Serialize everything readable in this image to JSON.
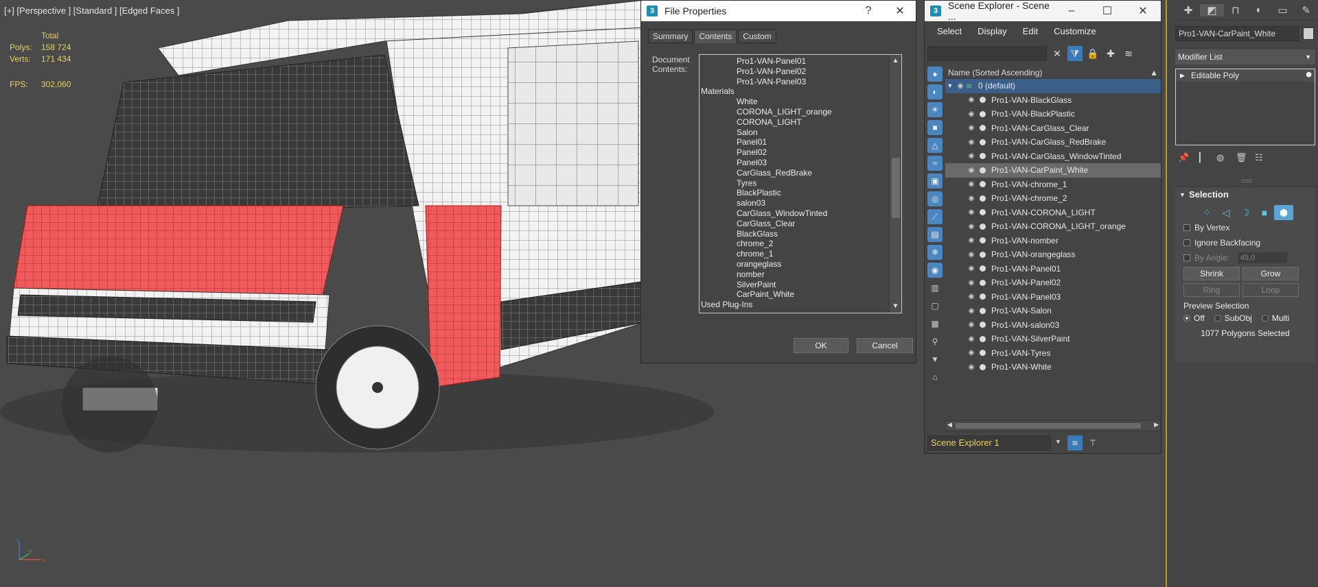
{
  "viewport": {
    "label": "[+] [Perspective ] [Standard ] [Edged Faces ]",
    "stats": {
      "total_label": "Total",
      "polys_label": "Polys:",
      "polys_value": "158 724",
      "verts_label": "Verts:",
      "verts_value": "171 434",
      "fps_label": "FPS:",
      "fps_value": "302,060"
    },
    "axis": {
      "x": "x",
      "y": "y",
      "z": "z"
    }
  },
  "file_properties": {
    "title": "File Properties",
    "help": "?",
    "close": "✕",
    "tabs": [
      "Summary",
      "Contents",
      "Custom"
    ],
    "active_tab": "Contents",
    "doc_label": "Document Contents:",
    "items": [
      {
        "text": "Pro1-VAN-Panel01",
        "indent": true
      },
      {
        "text": "Pro1-VAN-Panel02",
        "indent": true
      },
      {
        "text": "Pro1-VAN-Panel03",
        "indent": true
      },
      {
        "text": "Materials",
        "indent": false
      },
      {
        "text": "White",
        "indent": true
      },
      {
        "text": "CORONA_LIGHT_orange",
        "indent": true
      },
      {
        "text": "CORONA_LIGHT",
        "indent": true
      },
      {
        "text": "Salon",
        "indent": true
      },
      {
        "text": "Panel01",
        "indent": true
      },
      {
        "text": "Panel02",
        "indent": true
      },
      {
        "text": "Panel03",
        "indent": true
      },
      {
        "text": "CarGlass_RedBrake",
        "indent": true
      },
      {
        "text": "Tyres",
        "indent": true
      },
      {
        "text": "BlackPlastic",
        "indent": true
      },
      {
        "text": "salon03",
        "indent": true
      },
      {
        "text": "CarGlass_WindowTinted",
        "indent": true
      },
      {
        "text": "CarGlass_Clear",
        "indent": true
      },
      {
        "text": "BlackGlass",
        "indent": true
      },
      {
        "text": "chrome_2",
        "indent": true
      },
      {
        "text": "chrome_1",
        "indent": true
      },
      {
        "text": "orangeglass",
        "indent": true
      },
      {
        "text": "nomber",
        "indent": true
      },
      {
        "text": "SilverPaint",
        "indent": true
      },
      {
        "text": "CarPaint_White",
        "indent": true
      },
      {
        "text": "Used Plug-Ins",
        "indent": false
      }
    ],
    "ok": "OK",
    "cancel": "Cancel"
  },
  "scene_explorer": {
    "title": "Scene Explorer - Scene ...",
    "min": "–",
    "max": "☐",
    "close": "✕",
    "menu": [
      "Select",
      "Display",
      "Edit",
      "Customize"
    ],
    "column_header": "Name (Sorted Ascending)",
    "root": "0 (default)",
    "objects": [
      "Pro1-VAN-BlackGlass",
      "Pro1-VAN-BlackPlastic",
      "Pro1-VAN-CarGlass_Clear",
      "Pro1-VAN-CarGlass_RedBrake",
      "Pro1-VAN-CarGlass_WindowTinted",
      "Pro1-VAN-CarPaint_White",
      "Pro1-VAN-chrome_1",
      "Pro1-VAN-chrome_2",
      "Pro1-VAN-CORONA_LIGHT",
      "Pro1-VAN-CORONA_LIGHT_orange",
      "Pro1-VAN-nomber",
      "Pro1-VAN-orangeglass",
      "Pro1-VAN-Panel01",
      "Pro1-VAN-Panel02",
      "Pro1-VAN-Panel03",
      "Pro1-VAN-Salon",
      "Pro1-VAN-salon03",
      "Pro1-VAN-SilverPaint",
      "Pro1-VAN-Tyres",
      "Pro1-VAN-White"
    ],
    "selected_object": "Pro1-VAN-CarPaint_White",
    "explorer_name": "Scene Explorer 1"
  },
  "command_panel": {
    "object_name": "Pro1-VAN-CarPaint_White",
    "modifier_list": "Modifier List",
    "stack_item": "Editable Poly",
    "selection": {
      "title": "Selection",
      "by_vertex": "By Vertex",
      "ignore_backfacing": "Ignore Backfacing",
      "by_angle": "By Angle:",
      "angle_value": "45,0",
      "shrink": "Shrink",
      "grow": "Grow",
      "ring": "Ring",
      "loop": "Loop",
      "preview_selection": "Preview Selection",
      "off": "Off",
      "subobj": "SubObj",
      "multi": "Multi",
      "count": "1077 Polygons Selected"
    }
  },
  "colors": {
    "viewport_bg": "#4a4a4a",
    "selection_red": "#e84a4a",
    "stats_yellow": "#e5d35a",
    "tree_root": "#3c5f8a",
    "active_border": "#b89a2a"
  }
}
